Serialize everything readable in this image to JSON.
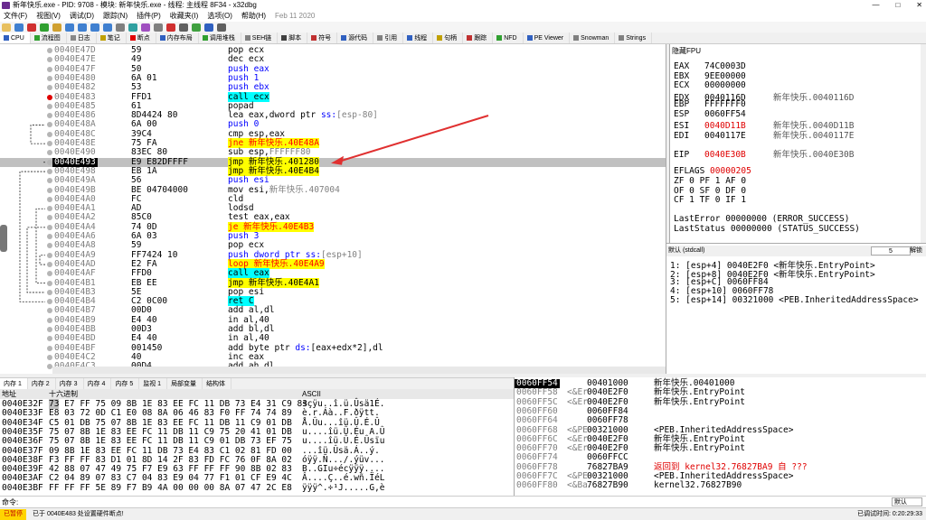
{
  "window": {
    "title": "新年快乐.exe - PID: 9708 - 模块: 新年快乐.exe - 线程: 主线程 8F34 - x32dbg",
    "controls": [
      "—",
      "□",
      "✕"
    ]
  },
  "menu": {
    "items": [
      "文件(F)",
      "视图(V)",
      "调试(D)",
      "跟踪(N)",
      "插件(P)",
      "收藏夹(I)",
      "选项(O)",
      "帮助(H)"
    ],
    "date": "Feb 11 2020"
  },
  "view_tabs": [
    {
      "label": "CPU",
      "color": "#3060c0"
    },
    {
      "label": "流程图",
      "color": "#30a030"
    },
    {
      "label": "日志",
      "color": "#888888"
    },
    {
      "label": "笔记",
      "color": "#c0a000"
    },
    {
      "label": "断点",
      "color": "#e00000"
    },
    {
      "label": "内存布局",
      "color": "#3060c0"
    },
    {
      "label": "调用堆栈",
      "color": "#30a030"
    },
    {
      "label": "SEH链",
      "color": "#808080"
    },
    {
      "label": "脚本",
      "color": "#404040"
    },
    {
      "label": "符号",
      "color": "#c03030"
    },
    {
      "label": "源代码",
      "color": "#3060c0"
    },
    {
      "label": "引用",
      "color": "#808080"
    },
    {
      "label": "线程",
      "color": "#3060c0"
    },
    {
      "label": "句柄",
      "color": "#c0a000"
    },
    {
      "label": "跟踪",
      "color": "#c03030"
    },
    {
      "label": "NFD",
      "color": "#30a030"
    },
    {
      "label": "PE Viewer",
      "color": "#3060c0"
    },
    {
      "label": "Snowman",
      "color": "#808080"
    },
    {
      "label": "Strings",
      "color": "#808080"
    }
  ],
  "disasm": [
    {
      "addr": "0040E47D",
      "bytes": "59",
      "ins": [
        {
          "t": "pop ecx"
        }
      ]
    },
    {
      "addr": "0040E47E",
      "bytes": "49",
      "ins": [
        {
          "t": "dec ecx"
        }
      ]
    },
    {
      "addr": "0040E47F",
      "bytes": "50",
      "ins": [
        {
          "t": "push eax",
          "c": "push"
        }
      ]
    },
    {
      "addr": "0040E480",
      "bytes": "6A 01",
      "ins": [
        {
          "t": "push 1",
          "c": "push"
        }
      ]
    },
    {
      "addr": "0040E482",
      "bytes": "53",
      "ins": [
        {
          "t": "push ebx",
          "c": "push"
        }
      ]
    },
    {
      "addr": "0040E483",
      "bytes": "FFD1",
      "ins": [
        {
          "t": "call ecx",
          "c": "call"
        }
      ],
      "bp": "red"
    },
    {
      "addr": "0040E485",
      "bytes": "61",
      "ins": [
        {
          "t": "popad"
        }
      ]
    },
    {
      "addr": "0040E486",
      "bytes": "8D4424 80",
      "ins": [
        {
          "t": "lea eax,dword ptr "
        },
        {
          "t": "ss:",
          "c": "seg"
        },
        {
          "t": "[esp-80]",
          "c": "num"
        }
      ]
    },
    {
      "addr": "0040E48A",
      "bytes": "6A 00",
      "ins": [
        {
          "t": "push 0",
          "c": "push"
        }
      ]
    },
    {
      "addr": "0040E48C",
      "bytes": "39C4",
      "ins": [
        {
          "t": "cmp esp,eax"
        }
      ]
    },
    {
      "addr": "0040E48E",
      "bytes": "75 FA",
      "ins": [
        {
          "t": "jne 新年快乐.40E48A",
          "c": "jcc"
        }
      ]
    },
    {
      "addr": "0040E490",
      "bytes": "83EC 80",
      "ins": [
        {
          "t": "sub esp,"
        },
        {
          "t": "FFFFFF80",
          "c": "num"
        }
      ]
    },
    {
      "addr": "0040E493",
      "bytes": "E9 E82DFFFF",
      "ins": [
        {
          "t": "jmp 新年快乐.401280",
          "c": "jmp"
        }
      ],
      "cur": true,
      "hl": true
    },
    {
      "addr": "0040E498",
      "bytes": "EB 1A",
      "ins": [
        {
          "t": "jmp 新年快乐.40E4B4",
          "c": "jmp"
        }
      ]
    },
    {
      "addr": "0040E49A",
      "bytes": "56",
      "ins": [
        {
          "t": "push esi",
          "c": "push"
        }
      ]
    },
    {
      "addr": "0040E49B",
      "bytes": "BE 04704000",
      "ins": [
        {
          "t": "mov esi,"
        },
        {
          "t": "新年快乐.407004",
          "c": "lbl"
        }
      ]
    },
    {
      "addr": "0040E4A0",
      "bytes": "FC",
      "ins": [
        {
          "t": "cld"
        }
      ]
    },
    {
      "addr": "0040E4A1",
      "bytes": "AD",
      "ins": [
        {
          "t": "lodsd"
        }
      ]
    },
    {
      "addr": "0040E4A2",
      "bytes": "85C0",
      "ins": [
        {
          "t": "test eax,eax"
        }
      ]
    },
    {
      "addr": "0040E4A4",
      "bytes": "74 0D",
      "ins": [
        {
          "t": "je 新年快乐.40E4B3",
          "c": "jcc"
        }
      ]
    },
    {
      "addr": "0040E4A6",
      "bytes": "6A 03",
      "ins": [
        {
          "t": "push 3",
          "c": "push"
        }
      ]
    },
    {
      "addr": "0040E4A8",
      "bytes": "59",
      "ins": [
        {
          "t": "pop ecx"
        }
      ]
    },
    {
      "addr": "0040E4A9",
      "bytes": "FF7424 10",
      "ins": [
        {
          "t": "push dword ptr ",
          "c": "push"
        },
        {
          "t": "ss:",
          "c": "seg"
        },
        {
          "t": "[esp+10]",
          "c": "num"
        }
      ]
    },
    {
      "addr": "0040E4AD",
      "bytes": "E2 FA",
      "ins": [
        {
          "t": "loop 新年快乐.40E4A9",
          "c": "loop"
        }
      ]
    },
    {
      "addr": "0040E4AF",
      "bytes": "FFD0",
      "ins": [
        {
          "t": "call eax",
          "c": "call"
        }
      ]
    },
    {
      "addr": "0040E4B1",
      "bytes": "EB EE",
      "ins": [
        {
          "t": "jmp 新年快乐.40E4A1",
          "c": "jmp"
        }
      ]
    },
    {
      "addr": "0040E4B3",
      "bytes": "5E",
      "ins": [
        {
          "t": "pop esi"
        }
      ]
    },
    {
      "addr": "0040E4B4",
      "bytes": "C2 0C00",
      "ins": [
        {
          "t": "ret C",
          "c": "ret"
        }
      ]
    },
    {
      "addr": "0040E4B7",
      "bytes": "00D0",
      "ins": [
        {
          "t": "add al,dl"
        }
      ]
    },
    {
      "addr": "0040E4B9",
      "bytes": "E4 40",
      "ins": [
        {
          "t": "in al,40"
        }
      ]
    },
    {
      "addr": "0040E4BB",
      "bytes": "00D3",
      "ins": [
        {
          "t": "add bl,dl"
        }
      ]
    },
    {
      "addr": "0040E4BD",
      "bytes": "E4 40",
      "ins": [
        {
          "t": "in al,40"
        }
      ]
    },
    {
      "addr": "0040E4BF",
      "bytes": "001450",
      "ins": [
        {
          "t": "add byte ptr "
        },
        {
          "t": "ds:",
          "c": "seg"
        },
        {
          "t": "[eax+edx*2],dl"
        }
      ]
    },
    {
      "addr": "0040E4C2",
      "bytes": "40",
      "ins": [
        {
          "t": "inc eax"
        }
      ]
    },
    {
      "addr": "0040E4C3",
      "bytes": "00D4",
      "ins": [
        {
          "t": "add ah,dl"
        }
      ]
    }
  ],
  "registers": {
    "header": "隐藏FPU",
    "general": [
      {
        "name": "EAX",
        "value": "74C0003D",
        "comment": ""
      },
      {
        "name": "EBX",
        "value": "9EE00000",
        "comment": ""
      },
      {
        "name": "ECX",
        "value": "00000000",
        "comment": ""
      },
      {
        "name": "EDX",
        "value": "0040116D",
        "comment": "新年快乐.0040116D"
      },
      {
        "name": "EBP",
        "value": "FFFFFFF0",
        "comment": ""
      },
      {
        "name": "ESP",
        "value": "0060FF54",
        "comment": ""
      },
      {
        "name": "ESI",
        "value": "0040D11B",
        "comment": "新年快乐.0040D11B",
        "red": true
      },
      {
        "name": "EDI",
        "value": "0040117E",
        "comment": "新年快乐.0040117E"
      }
    ],
    "eip": {
      "name": "EIP",
      "value": "0040E30B",
      "comment": "新年快乐.0040E30B",
      "red": true
    },
    "eflags": {
      "name": "EFLAGS",
      "value": "00000205"
    },
    "flags": [
      "ZF 0  PF 1  AF 0",
      "OF 0  SF 0  DF 0",
      "CF 1  TF 0  IF 1"
    ],
    "last_error": "LastError  00000000 (ERROR_SUCCESS)",
    "last_status": "LastStatus 00000000 (STATUS_SUCCESS)"
  },
  "callconv": {
    "label": "默认 (stdcall)",
    "count": "5",
    "unlock": "解锁",
    "args": [
      "1: [esp+4] 0040E2F0 <新年快乐.EntryPoint>",
      "2: [esp+8] 0040E2F0 <新年快乐.EntryPoint>",
      "3: [esp+C] 0060FF84",
      "4: [esp+10] 0060FF78",
      "5: [esp+14] 00321000 <PEB.InheritedAddressSpace>"
    ]
  },
  "dump_tabs": [
    "内存 1",
    "内存 2",
    "内存 3",
    "内存 4",
    "内存 5",
    "监视 1",
    "局部变量",
    "结构体"
  ],
  "dump": {
    "col_addr": "地址",
    "col_hex": "十六进制",
    "col_ascii": "ASCII",
    "rows": [
      {
        "addr": "0040E32F",
        "sel": "73",
        "hex": " E7 FF 75 09 8B 1E 83 EE FC 11 DB 73 E4 31 C9 83",
        "ascii": "sçÿu..î.ü.Ûsä1É."
      },
      {
        "addr": "0040E33F",
        "sel": "",
        "hex": "E8 03 72 0D C1 E0 08 8A 06 46 83 F0 FF 74 74 89",
        "ascii": "è.r.Áà..F.ðÿtt."
      },
      {
        "addr": "0040E34F",
        "sel": "",
        "hex": "C5 01 DB 75 07 8B 1E 83 EE FC 11 DB 11 C9 01 DB",
        "ascii": "Å.Ûu...îü.Û.É.Û"
      },
      {
        "addr": "0040E35F",
        "sel": "",
        "hex": "75 07 8B 1E 83 EE FC 11 DB 11 C9 75 20 41 01 DB",
        "ascii": "u....îü.Û.Éu A.Û"
      },
      {
        "addr": "0040E36F",
        "sel": "",
        "hex": "75 07 8B 1E 83 EE FC 11 DB 11 C9 01 DB 73 EF 75",
        "ascii": "u....îü.Û.É.Ûsïu"
      },
      {
        "addr": "0040E37F",
        "sel": "",
        "hex": "09 8B 1E 83 EE FC 11 DB 73 E4 83 C1 02 81 FD 00",
        "ascii": "...îü.Ûsä.Á..ý."
      },
      {
        "addr": "0040E38F",
        "sel": "",
        "hex": "F3 FF FF 83 D1 01 8D 14 2F 83 FD FC 76 0F 8A 02",
        "ascii": "óÿÿ.Ñ.../.ýüv..."
      },
      {
        "addr": "0040E39F",
        "sel": "",
        "hex": "42 88 07 47 49 75 F7 E9 63 FF FF FF 90 8B 02 83",
        "ascii": "B..GIu÷écÿÿÿ...."
      },
      {
        "addr": "0040E3AF",
        "sel": "",
        "hex": "C2 04 89 07 83 C7 04 83 E9 04 77 F1 01 CF E9 4C",
        "ascii": "Â....Ç..é.wñ.ÏéL"
      },
      {
        "addr": "0040E3BF",
        "sel": "",
        "hex": "FF FF FF 5E 89 F7 B9 4A 00 00 00 8A 07 47 2C E8",
        "ascii": "ÿÿÿ^.÷¹J.....G,è"
      }
    ]
  },
  "stack": [
    {
      "addr": "0060FF54",
      "s": "",
      "val": "00401000",
      "cmt": "新年快乐.00401000",
      "top": true
    },
    {
      "addr": "0060FF58",
      "s": "<&Er",
      "val": "0040E2F0",
      "cmt": "新年快乐.EntryPoint"
    },
    {
      "addr": "0060FF5C",
      "s": "<&Er",
      "val": "0040E2F0",
      "cmt": "新年快乐.EntryPoint"
    },
    {
      "addr": "0060FF60",
      "s": "",
      "val": "0060FF84",
      "cmt": ""
    },
    {
      "addr": "0060FF64",
      "s": "",
      "val": "0060FF78",
      "cmt": ""
    },
    {
      "addr": "0060FF68",
      "s": "<&PE",
      "val": "00321000",
      "cmt": "<PEB.InheritedAddressSpace>"
    },
    {
      "addr": "0060FF6C",
      "s": "<&Er",
      "val": "0040E2F0",
      "cmt": "新年快乐.EntryPoint"
    },
    {
      "addr": "0060FF70",
      "s": "<&Er",
      "val": "0040E2F0",
      "cmt": "新年快乐.EntryPoint"
    },
    {
      "addr": "0060FF74",
      "s": "",
      "val": "0060FFCC",
      "cmt": ""
    },
    {
      "addr": "0060FF78",
      "s": "",
      "val": "76827BA9",
      "cmt": "返回到 kernel32.76827BA9 自 ???",
      "red": true
    },
    {
      "addr": "0060FF7C",
      "s": "<&PE",
      "val": "00321000",
      "cmt": "<PEB.InheritedAddressSpace>"
    },
    {
      "addr": "0060FF80",
      "s": "<&Ba",
      "val": "76827B90",
      "cmt": "kernel32.76827B90"
    }
  ],
  "command": {
    "label": "命令:",
    "default": "默认"
  },
  "status": {
    "state": "已暂停",
    "message": "已于 0040E483 处设置硬件断点!",
    "time_label": "已调试时间:",
    "time_value": "0:20:29:33"
  },
  "colors": {
    "accent_arrow": "#e03030",
    "paused_bg": "#ffd400"
  }
}
